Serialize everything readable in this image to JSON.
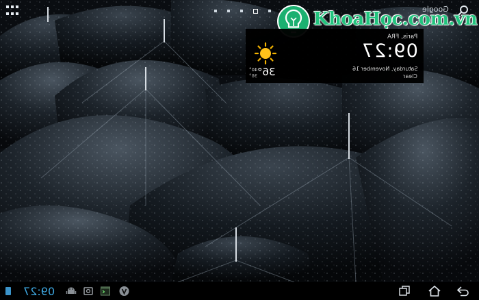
{
  "top_bar": {
    "google_label": "Google",
    "page_dot_count": 5,
    "active_page_index": 3
  },
  "watermark": {
    "text": "KhoaHọc.com.vn",
    "color": "#22c47e"
  },
  "weather": {
    "city": "Paris, FRA",
    "time": "09:27",
    "date": "Saturday, November 16",
    "condition": "Clear",
    "temperature": "36°",
    "high": "40°",
    "low": "36°",
    "icon": "sun-icon"
  },
  "navbar": {
    "clock": "09:27",
    "accent_color": "#3ea7e0",
    "icons": [
      "status-icon",
      "android-icon",
      "camera-icon",
      "terminal-icon",
      "v-app-icon",
      "recent-apps-icon",
      "home-icon",
      "back-icon"
    ]
  }
}
